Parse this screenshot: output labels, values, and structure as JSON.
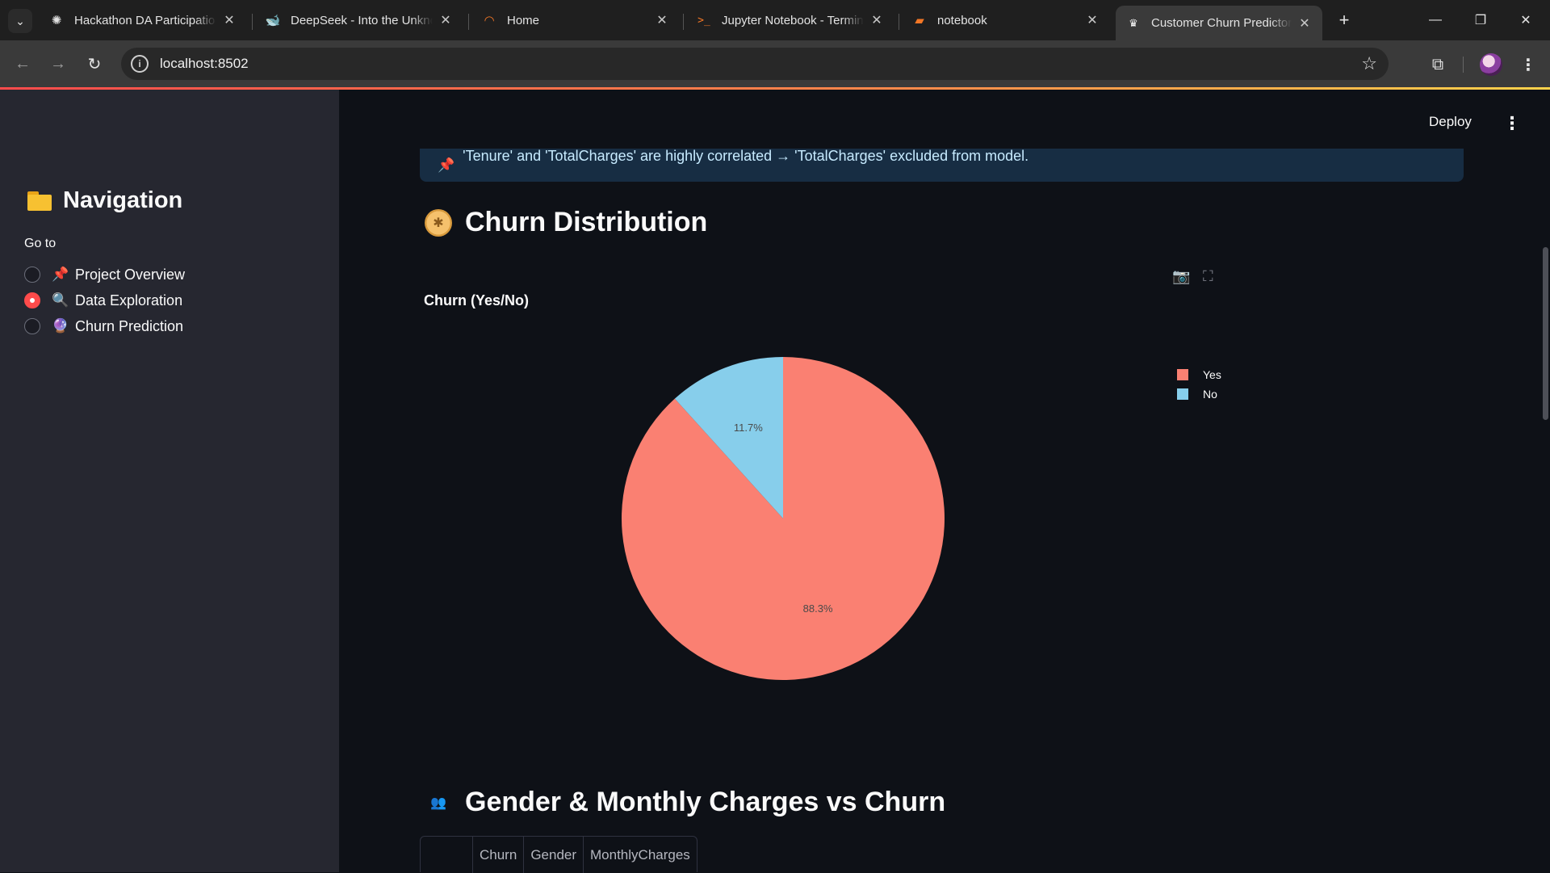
{
  "browser": {
    "tabs": [
      {
        "title": "Hackathon DA Participation",
        "icon": "openai-icon"
      },
      {
        "title": "DeepSeek - Into the Unknown",
        "icon": "deepseek-icon"
      },
      {
        "title": "Home",
        "icon": "jupyter-icon"
      },
      {
        "title": "Jupyter Notebook - Terminal",
        "icon": "terminal-icon"
      },
      {
        "title": "notebook",
        "icon": "notebook-icon"
      },
      {
        "title": "Customer Churn Predictor",
        "icon": "streamlit-icon",
        "active": true
      }
    ],
    "url": "localhost:8502"
  },
  "app": {
    "deploy_label": "Deploy",
    "sidebar": {
      "title": "Navigation",
      "goto_label": "Go to",
      "options": [
        {
          "emoji": "📌",
          "label": "Project Overview",
          "selected": false
        },
        {
          "emoji": "🔍",
          "label": "Data Exploration",
          "selected": true
        },
        {
          "emoji": "🔮",
          "label": "Churn Prediction",
          "selected": false
        }
      ]
    },
    "info_message": "'Tenure' and 'TotalCharges' are highly correlated → 'TotalCharges' excluded from model.",
    "section1_title": "Churn Distribution",
    "section2_title": "Gender & Monthly Charges vs Churn",
    "table_headers": [
      "Churn",
      "Gender",
      "MonthlyCharges"
    ]
  },
  "chart_data": {
    "type": "pie",
    "title": "Churn (Yes/No)",
    "categories": [
      "Yes",
      "No"
    ],
    "values": [
      88.3,
      11.7
    ],
    "labels": [
      "88.3%",
      "11.7%"
    ],
    "colors": [
      "#fa8072",
      "#87ceeb"
    ],
    "legend_position": "top-right"
  }
}
